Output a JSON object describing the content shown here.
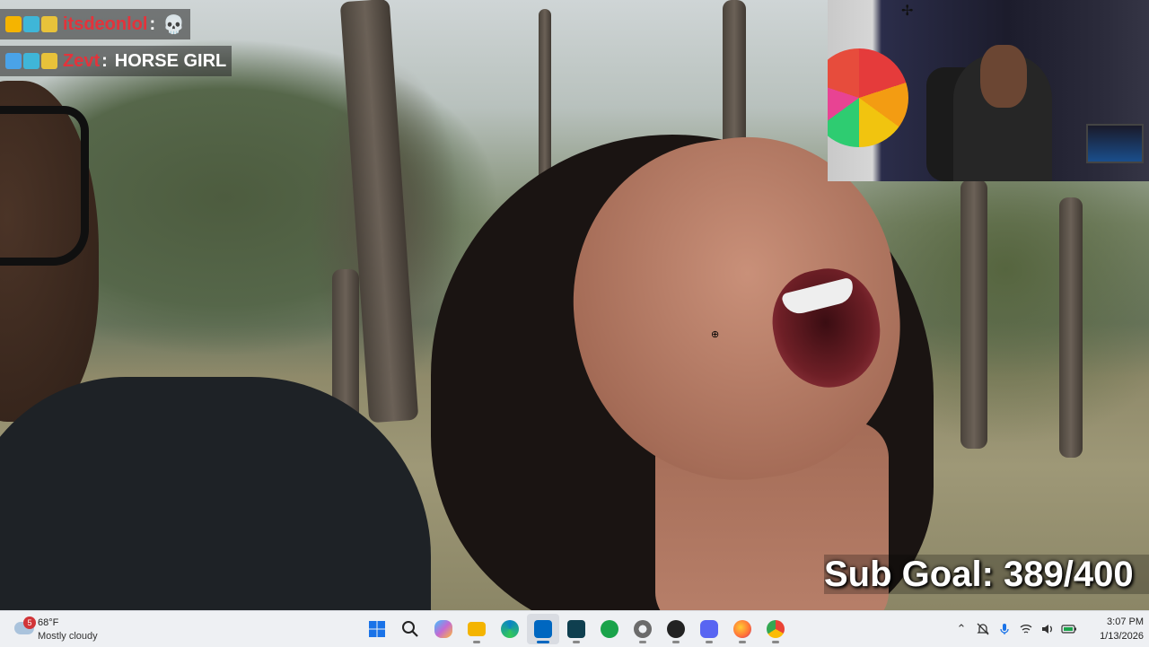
{
  "chat": {
    "messages": [
      {
        "user": "itsdeonlol",
        "user_color": "#e3333b",
        "separator": ":",
        "text": "💀"
      },
      {
        "user": "Zevt",
        "user_color": "#e3333b",
        "separator": ":",
        "text": "HORSE GIRL"
      }
    ]
  },
  "overlay": {
    "sub_goal": "Sub Goal: 389/400"
  },
  "taskbar": {
    "weather": {
      "badge": "5",
      "temp": "68°F",
      "condition": "Mostly cloudy"
    },
    "apps": [
      {
        "name": "start",
        "color": "#1a73e8"
      },
      {
        "name": "search",
        "color": "#222222"
      },
      {
        "name": "copilot",
        "color": "#c46ad3"
      },
      {
        "name": "file-explorer",
        "color": "#f4b400"
      },
      {
        "name": "edge",
        "color": "#0a84c6"
      },
      {
        "name": "microsoft-store",
        "color": "#0067c0"
      },
      {
        "name": "terminal",
        "color": "#107c7c"
      },
      {
        "name": "evernote",
        "color": "#1aa34a"
      },
      {
        "name": "settings",
        "color": "#6b6b6b"
      },
      {
        "name": "obs",
        "color": "#222222"
      },
      {
        "name": "discord",
        "color": "#5865f2"
      },
      {
        "name": "firefox",
        "color": "#ff7139"
      },
      {
        "name": "chrome",
        "color": "#34a853"
      }
    ],
    "tray": {
      "chevron": "⌃",
      "clock_time": "3:07 PM",
      "clock_date": "1/13/2026"
    }
  }
}
